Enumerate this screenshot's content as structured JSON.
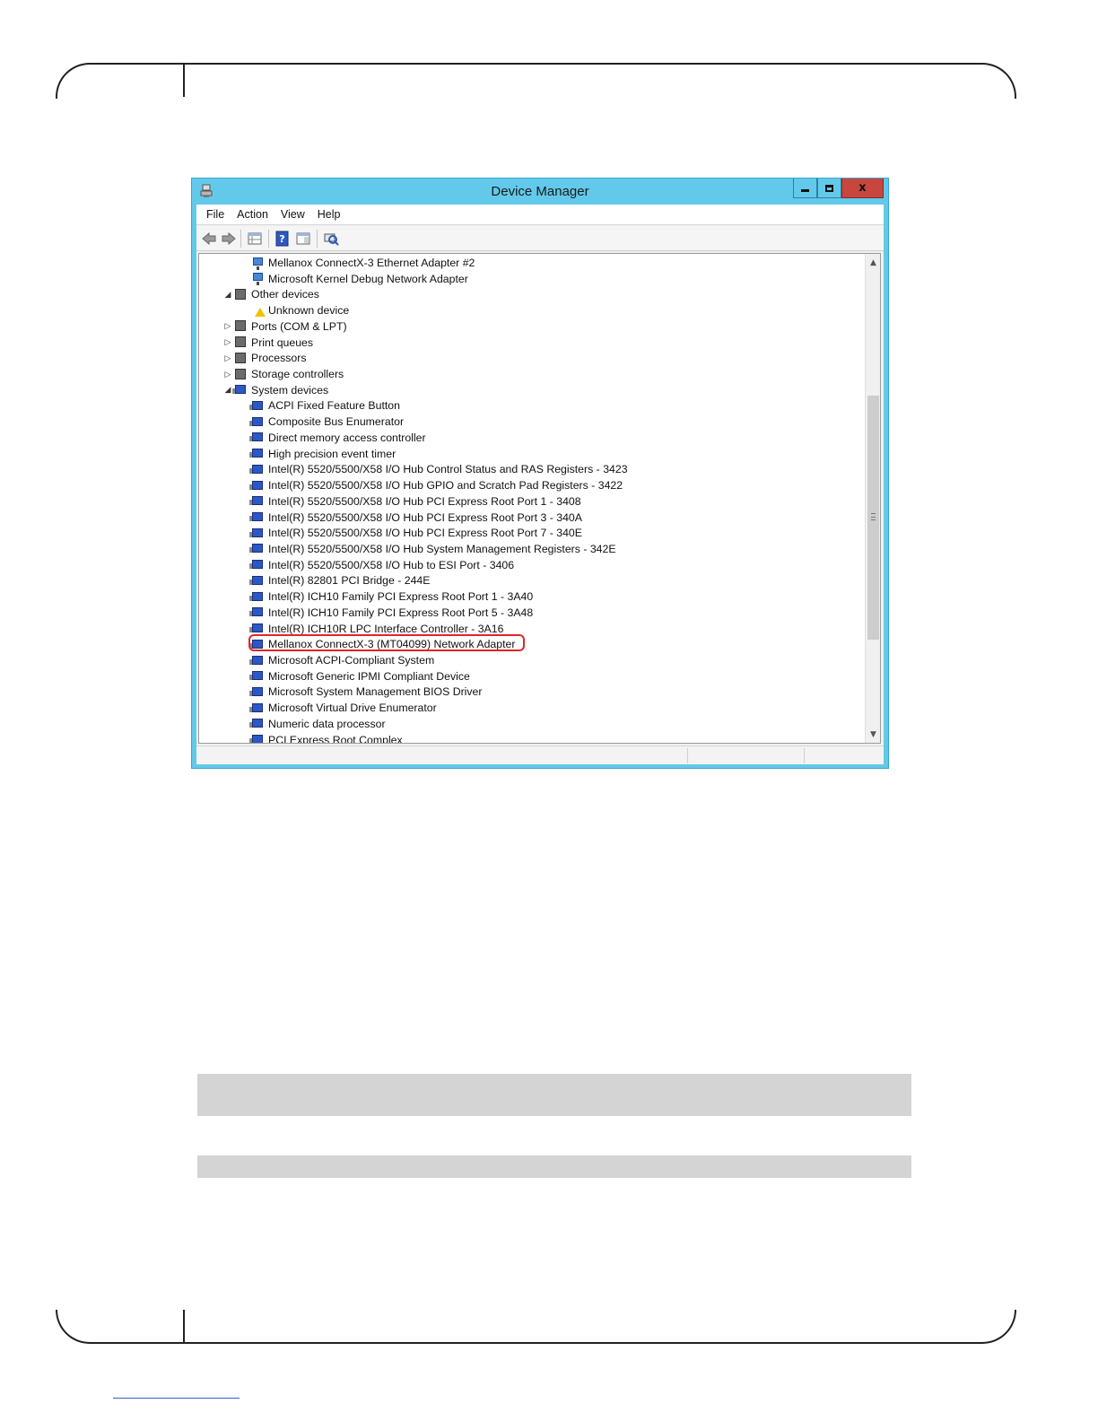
{
  "window": {
    "title": "Device Manager",
    "close_glyph": "x",
    "menu": [
      "File",
      "Action",
      "View",
      "Help"
    ]
  },
  "toolbar_icons": [
    "back-arrow-icon",
    "forward-arrow-icon",
    "properties-grid-icon",
    "help-icon",
    "view-panel-icon",
    "scan-hardware-icon"
  ],
  "tree": [
    {
      "label": "Mellanox ConnectX-3 Ethernet Adapter #2",
      "level": 2,
      "icon": "network-adapter-icon"
    },
    {
      "label": "Microsoft Kernel Debug Network Adapter",
      "level": 2,
      "icon": "network-adapter-icon"
    },
    {
      "label": "Other devices",
      "level": 1,
      "expanded": true,
      "icon": "unknown-category-icon"
    },
    {
      "label": "Unknown device",
      "level": 2,
      "icon": "warning-device-icon"
    },
    {
      "label": "Ports (COM & LPT)",
      "level": 1,
      "expanded": false,
      "icon": "port-icon"
    },
    {
      "label": "Print queues",
      "level": 1,
      "expanded": false,
      "icon": "printer-icon"
    },
    {
      "label": "Processors",
      "level": 1,
      "expanded": false,
      "icon": "processor-icon"
    },
    {
      "label": "Storage controllers",
      "level": 1,
      "expanded": false,
      "icon": "storage-icon"
    },
    {
      "label": "System devices",
      "level": 1,
      "expanded": true,
      "icon": "system-device-icon"
    },
    {
      "label": "ACPI Fixed Feature Button",
      "level": 2,
      "icon": "system-device-icon"
    },
    {
      "label": "Composite Bus Enumerator",
      "level": 2,
      "icon": "system-device-icon"
    },
    {
      "label": "Direct memory access controller",
      "level": 2,
      "icon": "system-device-icon"
    },
    {
      "label": "High precision event timer",
      "level": 2,
      "icon": "system-device-icon"
    },
    {
      "label": "Intel(R) 5520/5500/X58 I/O Hub Control Status and RAS Registers - 3423",
      "level": 2,
      "icon": "system-device-icon"
    },
    {
      "label": "Intel(R) 5520/5500/X58 I/O Hub GPIO and Scratch Pad Registers - 3422",
      "level": 2,
      "icon": "system-device-icon"
    },
    {
      "label": "Intel(R) 5520/5500/X58 I/O Hub PCI Express Root Port 1 - 3408",
      "level": 2,
      "icon": "system-device-icon"
    },
    {
      "label": "Intel(R) 5520/5500/X58 I/O Hub PCI Express Root Port 3 - 340A",
      "level": 2,
      "icon": "system-device-icon"
    },
    {
      "label": "Intel(R) 5520/5500/X58 I/O Hub PCI Express Root Port 7 - 340E",
      "level": 2,
      "icon": "system-device-icon"
    },
    {
      "label": "Intel(R) 5520/5500/X58 I/O Hub System Management Registers - 342E",
      "level": 2,
      "icon": "system-device-icon"
    },
    {
      "label": "Intel(R) 5520/5500/X58 I/O Hub to ESI Port - 3406",
      "level": 2,
      "icon": "system-device-icon"
    },
    {
      "label": "Intel(R) 82801 PCI Bridge - 244E",
      "level": 2,
      "icon": "system-device-icon"
    },
    {
      "label": "Intel(R) ICH10 Family PCI Express Root Port 1 - 3A40",
      "level": 2,
      "icon": "system-device-icon"
    },
    {
      "label": "Intel(R) ICH10 Family PCI Express Root Port 5 - 3A48",
      "level": 2,
      "icon": "system-device-icon"
    },
    {
      "label": "Intel(R) ICH10R LPC Interface Controller - 3A16",
      "level": 2,
      "icon": "system-device-icon"
    },
    {
      "label": "Mellanox ConnectX-3 (MT04099) Network Adapter",
      "level": 2,
      "icon": "system-device-icon",
      "highlighted": true
    },
    {
      "label": "Microsoft ACPI-Compliant System",
      "level": 2,
      "icon": "system-device-icon"
    },
    {
      "label": "Microsoft Generic IPMI Compliant Device",
      "level": 2,
      "icon": "system-device-icon"
    },
    {
      "label": "Microsoft System Management BIOS Driver",
      "level": 2,
      "icon": "system-device-icon"
    },
    {
      "label": "Microsoft Virtual Drive Enumerator",
      "level": 2,
      "icon": "system-device-icon"
    },
    {
      "label": "Numeric data processor",
      "level": 2,
      "icon": "system-device-icon"
    },
    {
      "label": "PCI Express Root Complex",
      "level": 2,
      "icon": "system-device-icon"
    }
  ],
  "colors": {
    "titlebar": "#62c9ea",
    "close_button": "#c7463d",
    "highlight": "#e0262a"
  }
}
